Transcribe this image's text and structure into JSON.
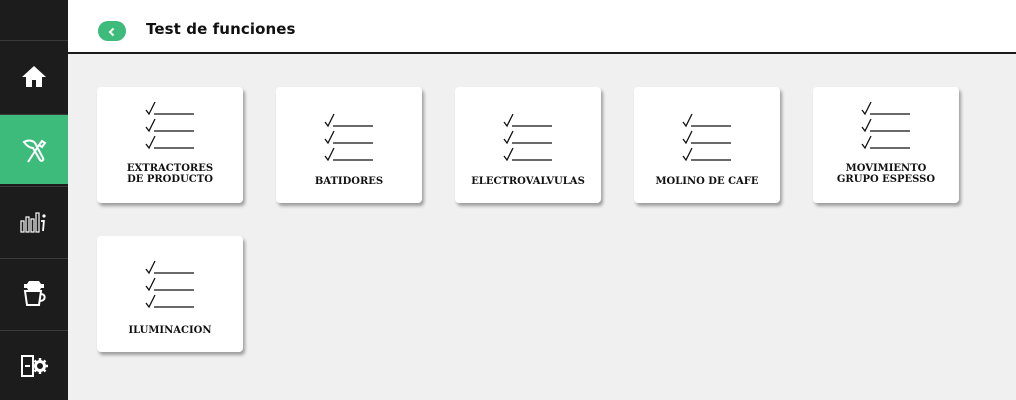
{
  "header": {
    "back_label": "<",
    "title": "Test de funciones"
  },
  "sidebar": {
    "items": [
      {
        "name": "home",
        "icon": "home-icon",
        "active": false
      },
      {
        "name": "tools",
        "icon": "tools-icon",
        "active": true
      },
      {
        "name": "statistics",
        "icon": "statistics-info-icon",
        "active": false
      },
      {
        "name": "cup-settings",
        "icon": "cup-settings-icon",
        "active": false
      },
      {
        "name": "machine-settings",
        "icon": "machine-gear-icon",
        "active": false
      }
    ]
  },
  "tiles": [
    {
      "label": "EXTRACTORES\nDE PRODUCTO",
      "icon": "checklist-icon"
    },
    {
      "label": "BATIDORES",
      "icon": "checklist-icon"
    },
    {
      "label": "ELECTROVALVULAS",
      "icon": "checklist-icon"
    },
    {
      "label": "MOLINO DE CAFE",
      "icon": "checklist-icon"
    },
    {
      "label": "MOVIMIENTO\nGRUPO ESPESSO",
      "icon": "checklist-icon"
    },
    {
      "label": "ILUMINACION",
      "icon": "checklist-icon"
    }
  ],
  "colors": {
    "accent": "#3dbb7b",
    "sidebar_bg": "#1c1c1c",
    "page_bg": "#f0f0f0"
  }
}
